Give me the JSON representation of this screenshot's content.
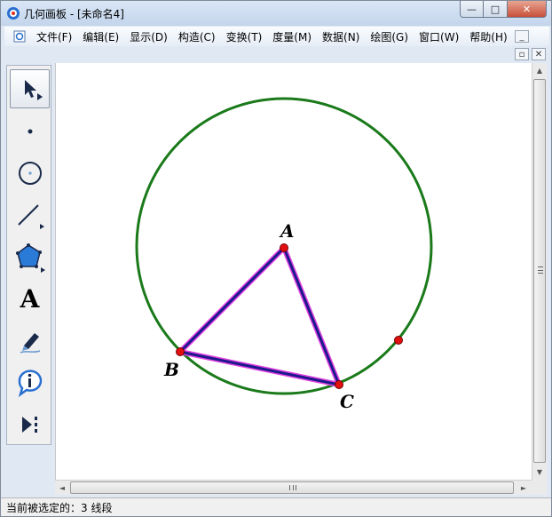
{
  "window": {
    "title": "几何画板 - [未命名4]",
    "buttons": {
      "minimize": "—",
      "maximize": "□",
      "close": "✕"
    }
  },
  "menu": {
    "items": [
      {
        "id": "file",
        "label": "文件(F)"
      },
      {
        "id": "edit",
        "label": "编辑(E)"
      },
      {
        "id": "display",
        "label": "显示(D)"
      },
      {
        "id": "construct",
        "label": "构造(C)"
      },
      {
        "id": "transform",
        "label": "变换(T)"
      },
      {
        "id": "measure",
        "label": "度量(M)"
      },
      {
        "id": "data",
        "label": "数据(N)"
      },
      {
        "id": "graph",
        "label": "绘图(G)"
      },
      {
        "id": "window",
        "label": "窗口(W)"
      },
      {
        "id": "help",
        "label": "帮助(H)"
      }
    ],
    "doc_buttons": {
      "minimize": "_",
      "restore": "▫",
      "close": "✕"
    }
  },
  "toolbox": {
    "tools": [
      {
        "id": "arrow",
        "icon": "arrow-select-icon",
        "selected": true
      },
      {
        "id": "point",
        "icon": "point-tool-icon"
      },
      {
        "id": "compass",
        "icon": "compass-circle-icon"
      },
      {
        "id": "straightedge",
        "icon": "line-segment-icon"
      },
      {
        "id": "polygon",
        "icon": "polygon-tool-icon"
      },
      {
        "id": "text",
        "icon": "text-tool-icon",
        "label": "A"
      },
      {
        "id": "marker",
        "icon": "marker-pen-icon"
      },
      {
        "id": "info",
        "icon": "info-tool-icon"
      },
      {
        "id": "custom",
        "icon": "custom-tool-icon"
      }
    ]
  },
  "sketch": {
    "points": [
      {
        "id": "A",
        "label": "A"
      },
      {
        "id": "B",
        "label": "B"
      },
      {
        "id": "C",
        "label": "C"
      }
    ],
    "colors": {
      "circle": "#1a7a1a",
      "segment": "#1a1a8c",
      "segment_highlight": "#e040e0",
      "point": "#e01010"
    }
  },
  "statusbar": {
    "text": "当前被选定的：3 线段"
  },
  "scrollbar": {
    "up": "▲",
    "down": "▼",
    "left": "◄",
    "right": "►"
  }
}
